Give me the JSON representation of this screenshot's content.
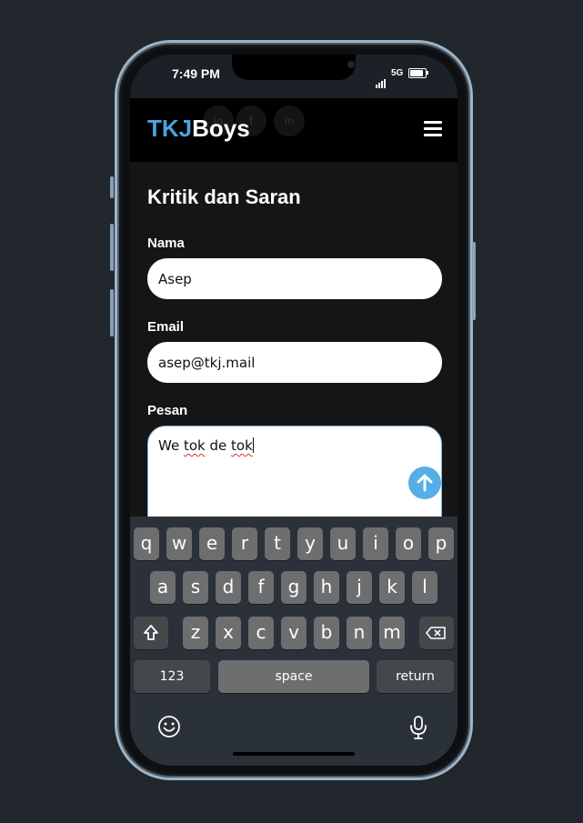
{
  "status_bar": {
    "time": "7:49 PM",
    "network": "5G"
  },
  "app": {
    "logo_part1": "TKJ",
    "logo_part2": "Boys",
    "brand_color": "#4aa3df",
    "menu_icon": "hamburger-icon"
  },
  "form": {
    "title": "Kritik dan Saran",
    "name_label": "Nama",
    "name_value": "Asep",
    "email_label": "Email",
    "email_value": "asep@tkj.mail",
    "message_label": "Pesan",
    "message_value": "We tok de tok",
    "send_icon": "arrow-up-icon"
  },
  "keyboard": {
    "row1": [
      "q",
      "w",
      "e",
      "r",
      "t",
      "y",
      "u",
      "i",
      "o",
      "p"
    ],
    "row2": [
      "a",
      "s",
      "d",
      "f",
      "g",
      "h",
      "j",
      "k",
      "l"
    ],
    "row3": [
      "z",
      "x",
      "c",
      "v",
      "b",
      "n",
      "m"
    ],
    "shift_icon": "shift-icon",
    "backspace_icon": "backspace-icon",
    "numbers_label": "123",
    "space_label": "space",
    "return_label": "return",
    "emoji_icon": "emoji-icon",
    "mic_icon": "microphone-icon"
  }
}
